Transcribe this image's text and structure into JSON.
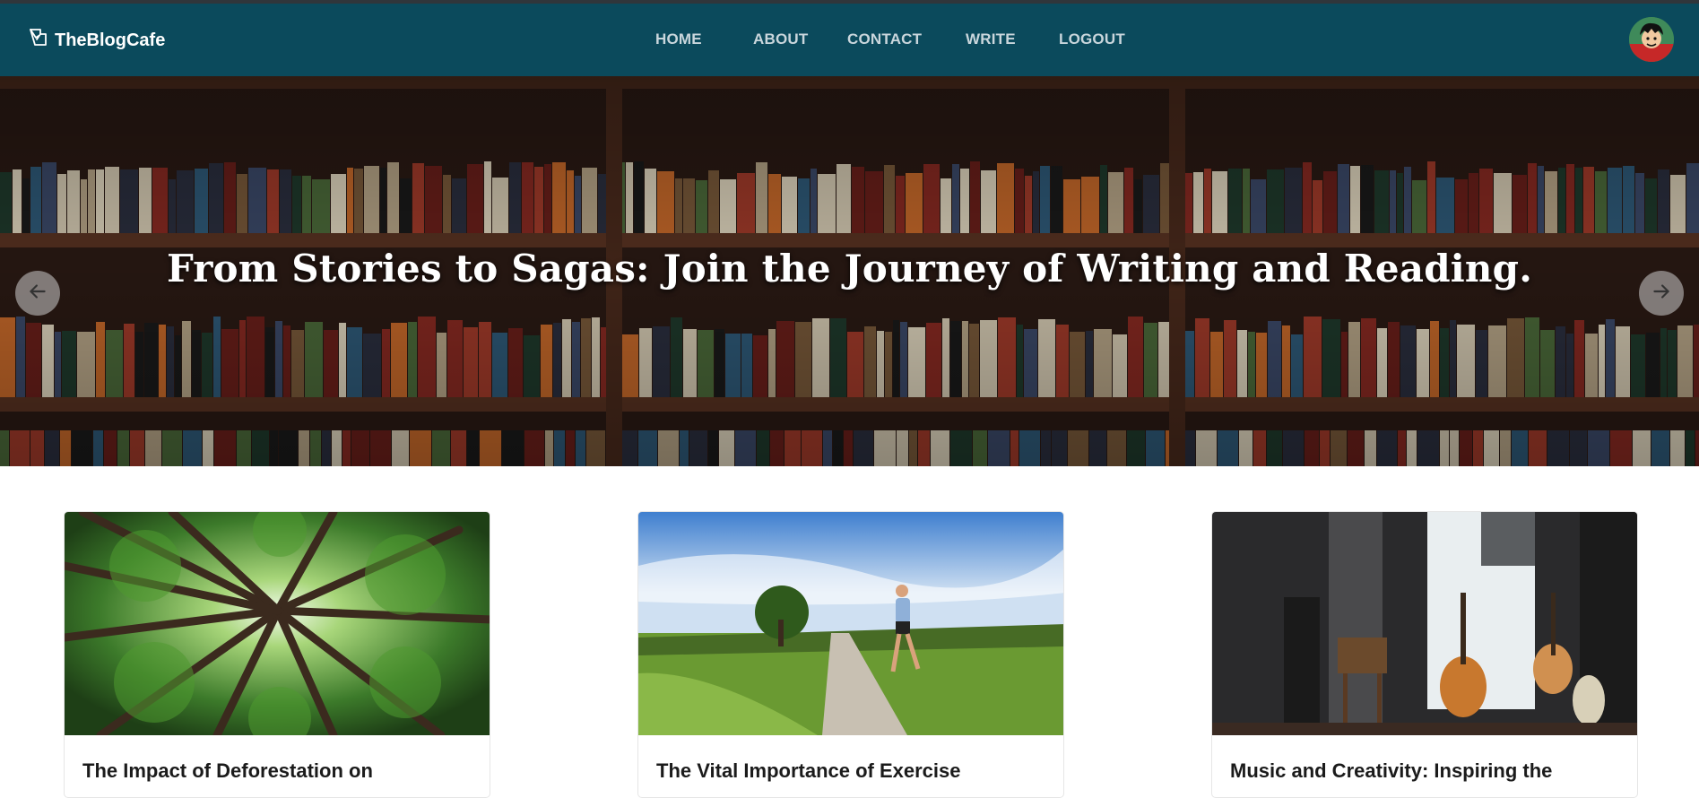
{
  "brand": {
    "name": "TheBlogCafe",
    "icon": "quill-icon"
  },
  "nav": {
    "items": [
      {
        "label": "HOME"
      },
      {
        "label": "ABOUT"
      },
      {
        "label": "CONTACT"
      },
      {
        "label": "WRITE"
      },
      {
        "label": "LOGOUT"
      }
    ]
  },
  "user": {
    "avatar": "user-avatar"
  },
  "hero": {
    "title": "From Stories to Sagas: Join the Journey of Writing and Reading.",
    "prev_icon": "arrow-left-icon",
    "next_icon": "arrow-right-icon"
  },
  "posts": [
    {
      "title": "The Impact of Deforestation on",
      "image": "forest-canopy"
    },
    {
      "title": "The Vital Importance of Exercise",
      "image": "runner-on-road"
    },
    {
      "title": "Music and Creativity: Inspiring the",
      "image": "music-room"
    }
  ],
  "colors": {
    "navbar": "#0b4a5c",
    "nav_text": "#c9d6dc",
    "card_title": "#1b1b1b"
  }
}
